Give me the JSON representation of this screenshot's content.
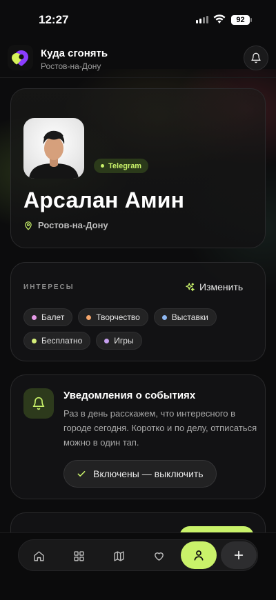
{
  "status": {
    "time": "12:27",
    "battery": "92"
  },
  "header": {
    "title": "Куда сгонять",
    "city": "Ростов-на-Дону"
  },
  "profile": {
    "badge": "Telegram",
    "name": "Арсалан Амин",
    "location": "Ростов-на-Дону"
  },
  "interests": {
    "label": "ИНТЕРЕСЫ",
    "edit_label": "Изменить",
    "chips": [
      {
        "label": "Балет",
        "color": "#e79be8"
      },
      {
        "label": "Творчество",
        "color": "#f5a66b"
      },
      {
        "label": "Выставки",
        "color": "#8eb8f3"
      },
      {
        "label": "Бесплатно",
        "color": "#d7f07a"
      },
      {
        "label": "Игры",
        "color": "#c7a0f0"
      }
    ]
  },
  "notifications": {
    "title": "Уведомления о событиях",
    "text": "Раз в день расскажем, что интересного в городе сегодня. Коротко и по делу, отписаться можно в один тап.",
    "toggle_label": "Включены — выключить"
  },
  "colors": {
    "accent": "#c9f26a",
    "background": "#0c0c0d",
    "card": "#141415"
  },
  "nav": {
    "items": [
      "home-icon",
      "grid-icon",
      "map-icon",
      "heart-icon",
      "profile-icon",
      "plus-icon"
    ],
    "active": "profile-icon"
  }
}
